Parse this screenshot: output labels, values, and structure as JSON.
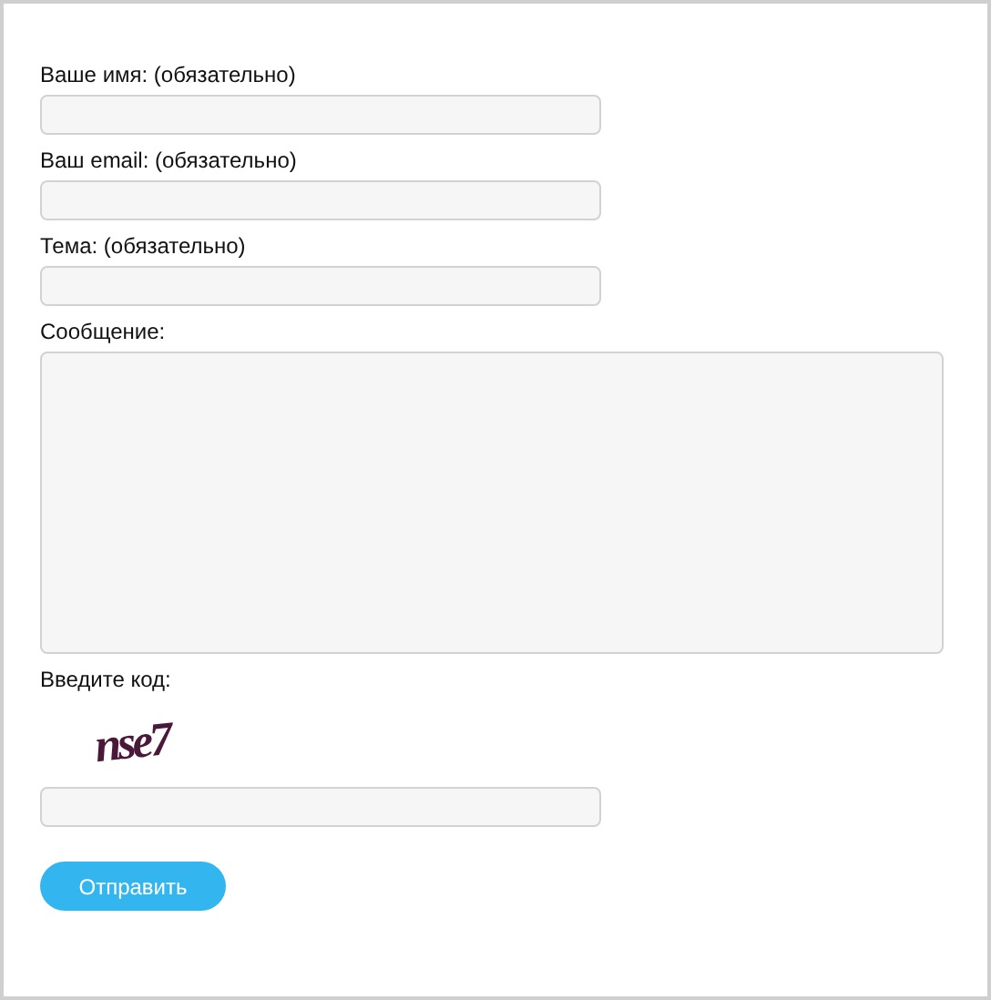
{
  "fields": [
    {
      "kind": "input",
      "label": "Ваше имя: (обязательно)"
    },
    {
      "kind": "input",
      "label": "Ваш email: (обязательно)"
    },
    {
      "kind": "input",
      "label": "Тема: (обязательно)"
    },
    {
      "kind": "textarea",
      "label": "Сообщение:"
    }
  ],
  "captcha": {
    "label": "Введите код:",
    "code": "nse7"
  },
  "submit": "Отправить"
}
